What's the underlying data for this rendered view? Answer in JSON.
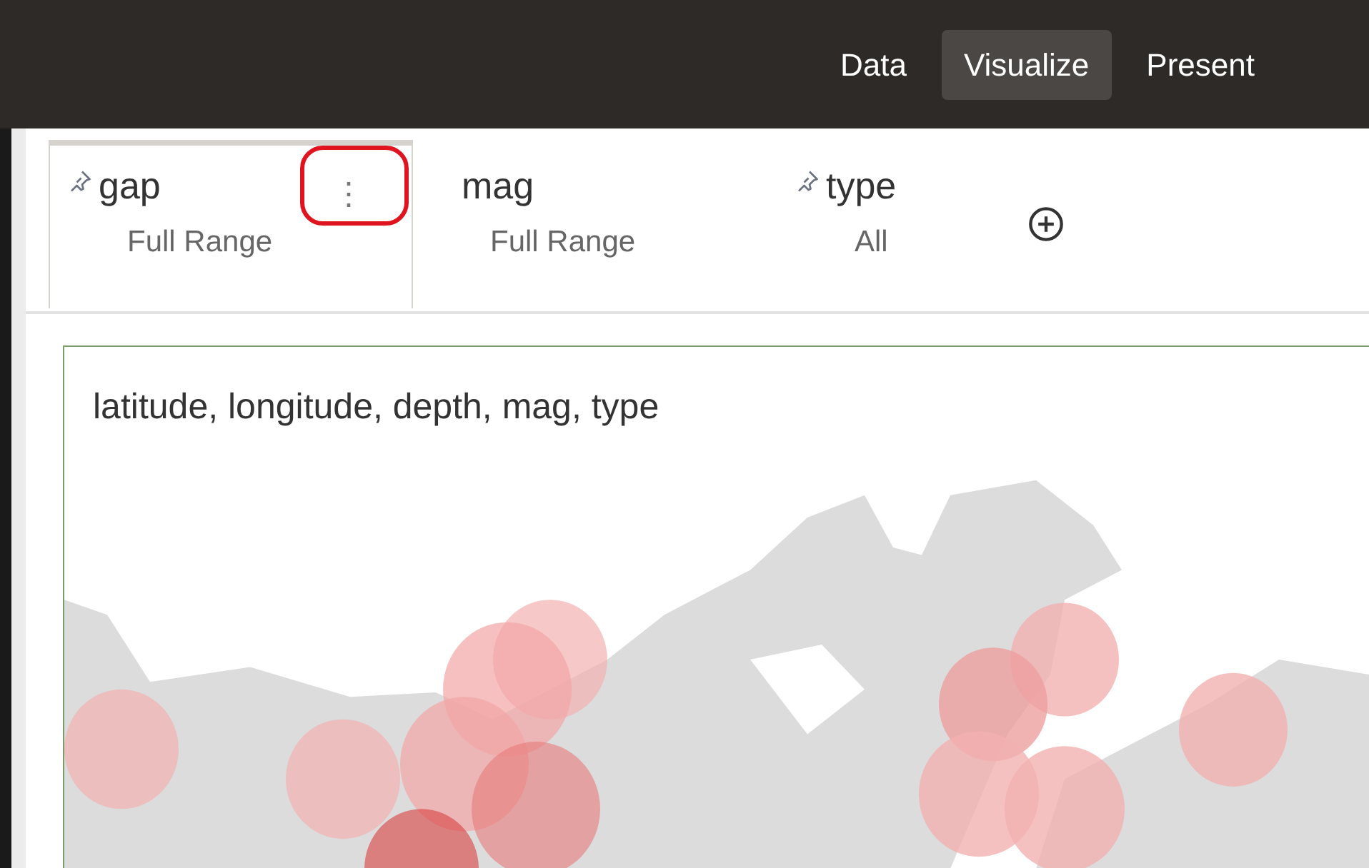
{
  "nav": {
    "tabs": [
      {
        "label": "Data",
        "selected": false
      },
      {
        "label": "Visualize",
        "selected": true
      },
      {
        "label": "Present",
        "selected": false
      }
    ]
  },
  "filters": [
    {
      "name": "gap",
      "value": "Full Range",
      "pinned": true,
      "selected": true,
      "menu_icon": "⋮",
      "menu_highlighted": true
    },
    {
      "name": "mag",
      "value": "Full Range",
      "pinned": false,
      "selected": false,
      "menu_highlighted": false
    },
    {
      "name": "type",
      "value": "All",
      "pinned": true,
      "selected": false,
      "menu_highlighted": false
    }
  ],
  "visualization": {
    "title": "latitude, longitude, depth, mag, type"
  }
}
